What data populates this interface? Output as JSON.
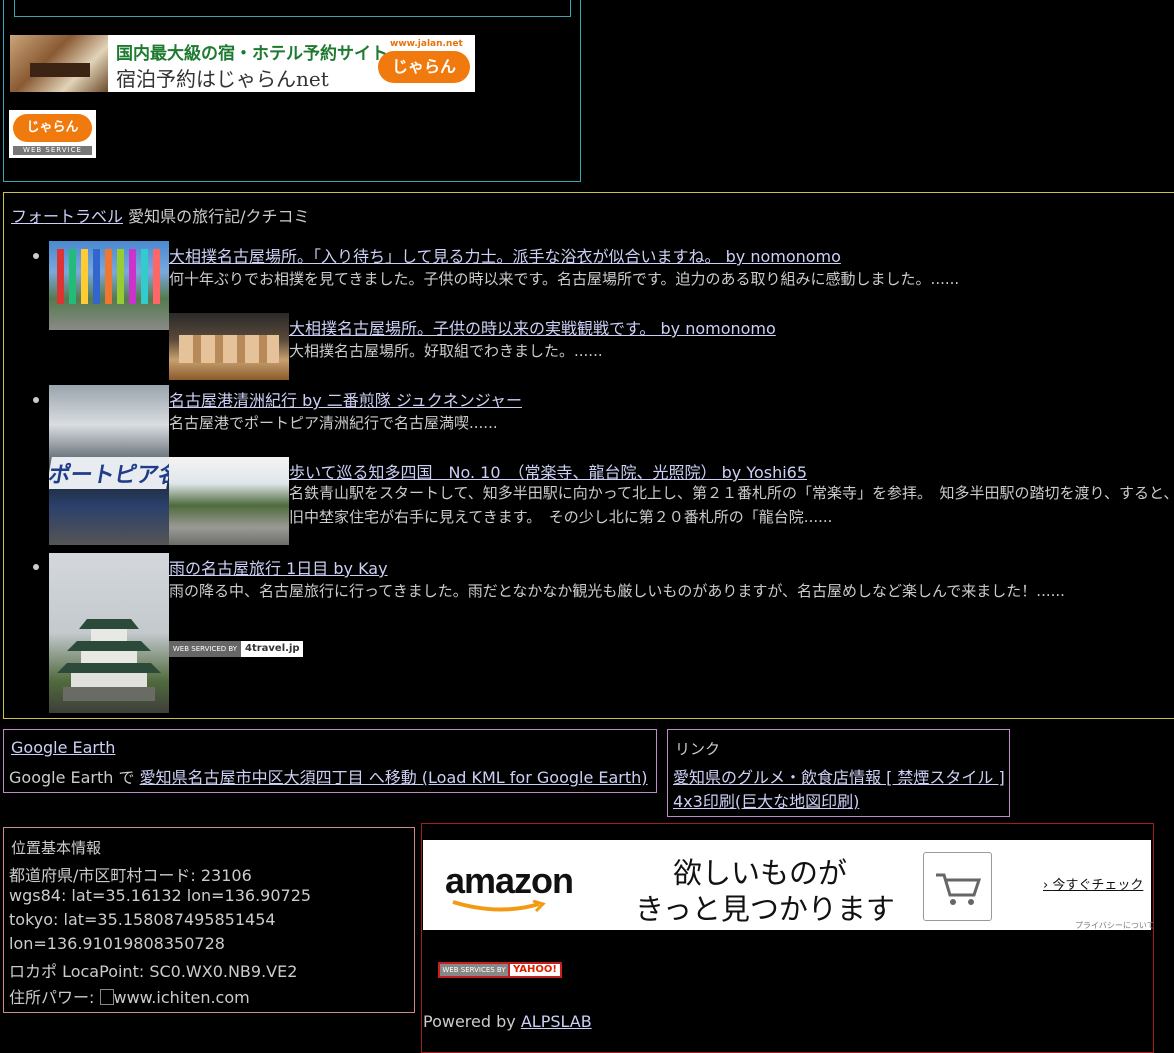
{
  "jalan": {
    "banner_line1": "国内最大級の宿・ホテル予約サイト",
    "banner_line2": "宿泊予約はじゃらんnet",
    "url": "www.jalan.net",
    "logo_text": "じゃらん",
    "ws_label": "WEB SERVICE"
  },
  "travel": {
    "site_link": "フォートラベル",
    "heading": "愛知県の旅行記/クチコミ",
    "items": [
      {
        "title": "大相撲名古屋場所。「入り待ち」して見る力士。派手な浴衣が似合いますね。 by nomonomo",
        "desc": "何十年ぶりでお相撲を見てきました。子供の時以来です。名古屋場所です。迫力のある取り組みに感動しました。......"
      },
      {
        "title": "大相撲名古屋場所。子供の時以来の実戦観戦です。 by nomonomo",
        "desc": "大相撲名古屋場所。好取組でわきました。......"
      },
      {
        "title": "名古屋港清洲紀行 by 二番煎隊 ジュクネンジャー",
        "desc": "名古屋港でポートピア清洲紀行で名古屋満喫......"
      },
      {
        "title": "歩いて巡る知多四国　No. 10　（常楽寺、龍台院、光照院） by Yoshi65",
        "desc": "名鉄青山駅をスタートして、知多半田駅に向かって北上し、第２１番札所の「常楽寺」を参拝。　知多半田駅の踏切を渡り、すると、旧中埜家住宅が右手に見えてきます。　その少し北に第２０番札所の「龍台院......"
      },
      {
        "title": "雨の名古屋旅行 1日目 by Kay",
        "desc": "雨の降る中、名古屋旅行に行ってきました。雨だとなかなか観光も厳しいものがありますが、名古屋めしなど楽しんで来ました！......"
      }
    ],
    "thumb_text": "ポートピア名古屋",
    "ws_left": "WEB SERVICED BY",
    "ws_right": "4travel.jp"
  },
  "google_earth": {
    "title": "Google Earth",
    "prefix": "Google Earth で",
    "link": "愛知県名古屋市中区大須四丁目 へ移動 (Load KML for Google Earth)"
  },
  "links": {
    "title": "リンク",
    "items": [
      "愛知県のグルメ・飲食店情報 [ 禁煙スタイル ]",
      "4x3印刷(巨大な地図印刷)"
    ]
  },
  "location": {
    "title": "位置基本情報",
    "lines": [
      "都道府県/市区町村コード: 23106",
      "wgs84: lat=35.16132 lon=136.90725",
      "tokyo: lat=35.158087495851454",
      "lon=136.91019808350728",
      "ロカポ LocaPoint: SC0.WX0.NB9.VE2"
    ],
    "address_label": "住所パワー:",
    "address_img_alt": "www.ichiten.com"
  },
  "amazon": {
    "logo": "amazon",
    "msg_line1": "欲しいものが",
    "msg_line2": "きっと見つかります",
    "check": "今すぐチェック",
    "privacy": "プライバシーについて"
  },
  "yahoo": {
    "left": "WEB SERVICES BY",
    "right": "YAHOO!"
  },
  "powered": {
    "prefix": "Powered by",
    "link": "ALPSLAB"
  }
}
